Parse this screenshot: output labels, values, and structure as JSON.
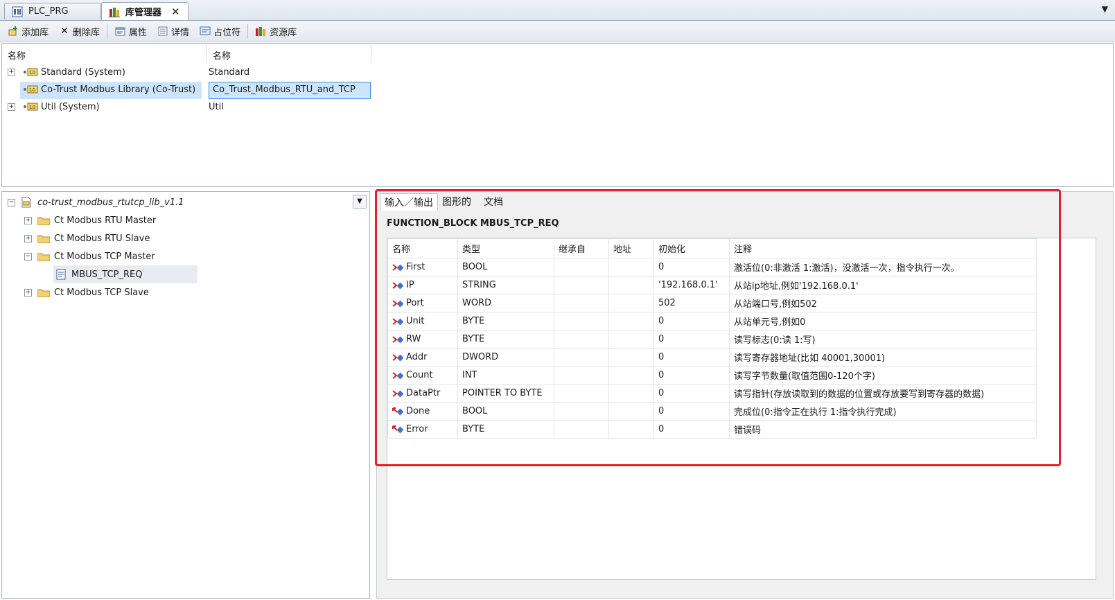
{
  "tabs": [
    {
      "label": "PLC_PRG",
      "active": false,
      "icon": "plc-program-icon"
    },
    {
      "label": "库管理器",
      "active": true,
      "icon": "library-manager-icon"
    }
  ],
  "toolbar": {
    "add_library": "添加库",
    "delete_library": "删除库",
    "properties": "属性",
    "details": "详情",
    "placeholder": "占位符",
    "repository": "资源库"
  },
  "library_list": {
    "col_name": "名称",
    "col_namespace": "名称",
    "rows": [
      {
        "name": "Standard (System)",
        "namespace": "Standard",
        "expandable": true,
        "selected": false
      },
      {
        "name": "Co-Trust Modbus Library (Co-Trust)",
        "namespace": "Co_Trust_Modbus_RTU_and_TCP",
        "expandable": false,
        "selected": true
      },
      {
        "name": "Util (System)",
        "namespace": "Util",
        "expandable": true,
        "selected": false
      }
    ]
  },
  "tree": {
    "root": "co-trust_modbus_rtutcp_lib_v1.1",
    "items": [
      {
        "label": "Ct Modbus RTU Master",
        "expanded": false
      },
      {
        "label": "Ct Modbus RTU Slave",
        "expanded": false
      },
      {
        "label": "Ct Modbus TCP Master",
        "expanded": true
      },
      {
        "label": "MBUS_TCP_REQ",
        "child": true
      },
      {
        "label": "Ct Modbus TCP Slave",
        "expanded": false
      }
    ]
  },
  "detail": {
    "tabs": [
      "输入／输出",
      "图形的",
      "文档"
    ],
    "function_block": "FUNCTION_BLOCK MBUS_TCP_REQ",
    "columns": [
      "名称",
      "类型",
      "继承自",
      "地址",
      "初始化",
      "注释"
    ],
    "rows": [
      {
        "dir": "input",
        "name": "First",
        "type": "BOOL",
        "inherited": "",
        "address": "",
        "init": "0",
        "comment": "激活位(0:非激活 1:激活)，没激活一次，指令执行一次。"
      },
      {
        "dir": "input",
        "name": "IP",
        "type": "STRING",
        "inherited": "",
        "address": "",
        "init": "'192.168.0.1'",
        "comment": "从站ip地址,例如'192.168.0.1'"
      },
      {
        "dir": "input",
        "name": "Port",
        "type": "WORD",
        "inherited": "",
        "address": "",
        "init": "502",
        "comment": "从站端口号,例如502"
      },
      {
        "dir": "input",
        "name": "Unit",
        "type": "BYTE",
        "inherited": "",
        "address": "",
        "init": "0",
        "comment": "从站单元号,例如0"
      },
      {
        "dir": "input",
        "name": "RW",
        "type": "BYTE",
        "inherited": "",
        "address": "",
        "init": "0",
        "comment": "读写标志(0:读 1:写)"
      },
      {
        "dir": "input",
        "name": "Addr",
        "type": "DWORD",
        "inherited": "",
        "address": "",
        "init": "0",
        "comment": "读写寄存器地址(比如 40001,30001)"
      },
      {
        "dir": "input",
        "name": "Count",
        "type": "INT",
        "inherited": "",
        "address": "",
        "init": "0",
        "comment": "读写字节数量(取值范围0-120个字)"
      },
      {
        "dir": "input",
        "name": "DataPtr",
        "type": "POINTER TO BYTE",
        "inherited": "",
        "address": "",
        "init": "0",
        "comment": "读写指针(存放读取到的数据的位置或存放要写到寄存器的数据)"
      },
      {
        "dir": "output",
        "name": "Done",
        "type": "BOOL",
        "inherited": "",
        "address": "",
        "init": "0",
        "comment": "完成位(0:指令正在执行 1:指令执行完成)"
      },
      {
        "dir": "output",
        "name": "Error",
        "type": "BYTE",
        "inherited": "",
        "address": "",
        "init": "0",
        "comment": "错误码"
      }
    ]
  },
  "colors": {
    "highlight": "#e6202a",
    "selection": "#cde5fb",
    "selection_border": "#3d8ee0"
  }
}
